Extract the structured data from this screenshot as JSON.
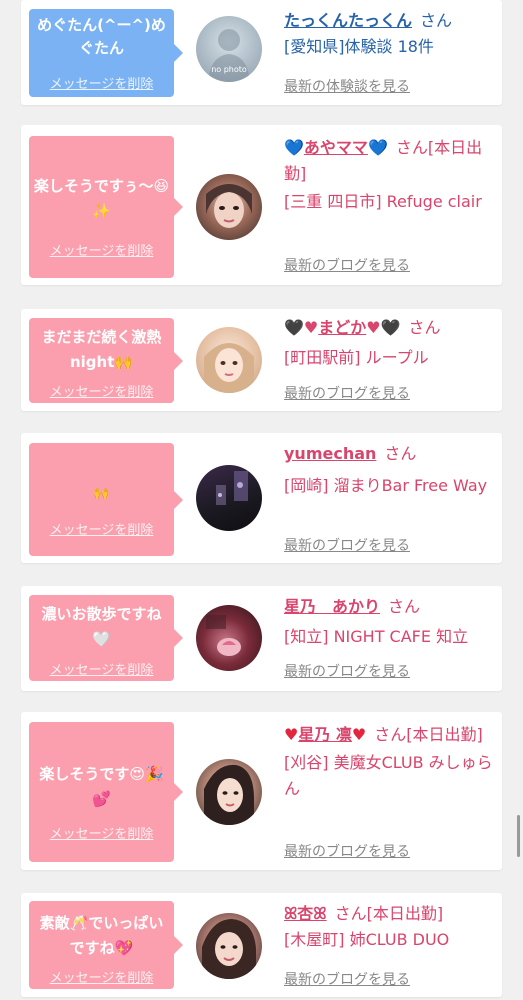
{
  "cards": [
    {
      "message": "めぐたん(^ー^)めぐたん",
      "delete_label": "メッセージを削除",
      "name": "たっくんたっくん",
      "san": "さん",
      "shop": "[愛知県]体験談 18件",
      "link": "最新の体験談を見る",
      "avatar_text": "no photo"
    },
    {
      "message": "楽しそうですぅ〜😆✨",
      "delete_label": "メッセージを削除",
      "name_prefix": "💙",
      "name": "あやママ",
      "name_suffix": "💙",
      "san": "さん[本日出勤]",
      "shop": "[三重 四日市] Refuge clair",
      "link": "最新のブログを見る"
    },
    {
      "message": "まだまだ続く激熱night🙌",
      "delete_label": "メッセージを削除",
      "name_prefix": "🖤♥",
      "name": "まどか",
      "name_suffix": "♥🖤",
      "san": "さん",
      "shop": "[町田駅前] ループル",
      "link": "最新のブログを見る"
    },
    {
      "message": "🙌",
      "delete_label": "メッセージを削除",
      "name": "yumechan",
      "san": "さん",
      "shop": "[岡崎] 溜まりBar Free Way",
      "link": "最新のブログを見る"
    },
    {
      "message": "濃いお散歩ですね🤍",
      "delete_label": "メッセージを削除",
      "name": "星乃　あかり",
      "san": "さん",
      "shop": "[知立] NIGHT CAFE 知立",
      "link": "最新のブログを見る"
    },
    {
      "message": "楽しそうです😍🎉💕",
      "delete_label": "メッセージを削除",
      "name_prefix": "♥",
      "name": "星乃 凛",
      "name_suffix": "♥",
      "san": "さん[本日出勤]",
      "shop": "[刈谷] 美魔女CLUB みしゅらん",
      "link": "最新のブログを見る"
    },
    {
      "message": "素敵🥂でいっぱいですね💖",
      "delete_label": "メッセージを削除",
      "name": "ꕤ杏ꕤ",
      "san": "さん[本日出勤]",
      "shop": "[木屋町] 姉CLUB DUO",
      "link": "最新のブログを見る"
    }
  ]
}
